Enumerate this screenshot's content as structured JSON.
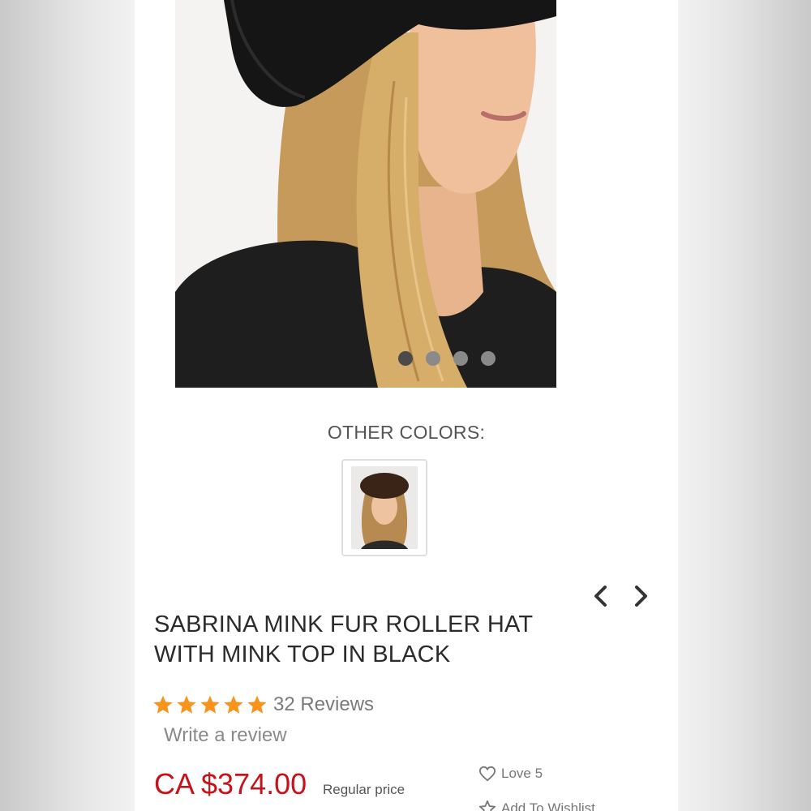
{
  "gallery": {
    "slide_count": 4,
    "active_slide": 1,
    "colors": {
      "dot_active": "#4a4a4a",
      "dot_inactive": "#8a8a8a"
    }
  },
  "other_colors": {
    "label": "OTHER COLORS:",
    "swatches": [
      {
        "icon": "brown-hat-thumbnail"
      }
    ]
  },
  "nav": {
    "prev_icon": "chevron-left-icon",
    "next_icon": "chevron-right-icon"
  },
  "product": {
    "title_line1": "SABRINA MINK FUR ROLLER HAT",
    "title_line2": "WITH MINK TOP IN BLACK",
    "rating": 5,
    "reviews_label": "32 Reviews",
    "write_review_label": "Write a review",
    "price": "CA $374.00",
    "price_note": "Regular price",
    "love_label": "Love 5",
    "wishlist_label": "Add To Wishlist"
  },
  "colors": {
    "price": "#c8121a",
    "star": "#f7941d",
    "text": "#2b2b2b"
  }
}
